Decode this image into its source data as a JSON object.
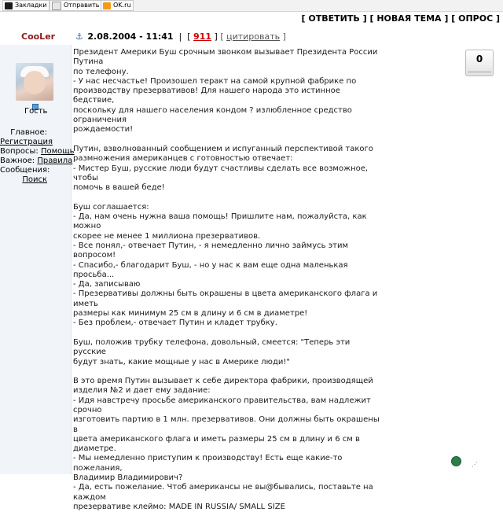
{
  "toolbar": {
    "bookmarks_label": "Закладки",
    "send_label": "Отправить",
    "ok_label": "OK.ru"
  },
  "actions": {
    "reply": "ОТВЕТИТЬ",
    "new_topic": "НОВАЯ ТЕМА",
    "poll": "ОПРОС"
  },
  "post_header": {
    "author": "CooLer",
    "date": "2.08.2004 - 11:41",
    "post_number": "911",
    "quote_label": "цитировать"
  },
  "user": {
    "status": "Гость"
  },
  "menu": {
    "main_label": "Главное:",
    "main_link": "Регистрация",
    "questions_label": "Вопросы:",
    "questions_link": "Помощь",
    "important_label": "Важное:",
    "important_link": "Правила",
    "messages_label": "Сообщения:",
    "messages_link": "Поиск"
  },
  "rating": {
    "value": "0"
  },
  "post": {
    "p1": "Президент Америки Буш срочным звонком вызывает Президента России Путина\nпо телефону.\n- У нас несчастье! Произошел теракт на самой крупной фабрике по\nпроизводству презервативов! Для нашего народа это истинное бедствие,\nпоскольку для нашего населения кондом ? излюбленное средство ограничения\nрождаемости!",
    "p2": "Путин, взволнованный сообщением и испуганный перспективой такого\nразмножения американцев с готовностью отвечает:\n- Мистер Буш, русские люди будут счастливы сделать все возможное, чтобы\nпомочь в вашей беде!",
    "p3": "Буш соглашается:\n- Да, нам очень нужна ваша помощь! Пришлите нам, пожалуйста, как можно\nскорее не менее 1 миллиона презервативов.\n- Все понял,- отвечает Путин, - я немедленно лично займусь этим\nвопросом!\n- Спасибо,- благодарит Буш, - но у нас к вам еще одна маленькая\nпросьба...\n- Да, записываю\n- Презервативы должны быть окрашены в цвета американского флага и иметь\nразмеры как минимум 25 см в длину и 6 см в диаметре!\n- Без проблем,- отвечает Путин и кладет трубку.",
    "p4": "Буш, положив трубку телефона, довольный, смеется: \"Теперь эти русские\nбудут знать, какие мощные у нас в Америке люди!\"",
    "p5": "В это время Путин вызывает к себе директора фабрики, производящей\nизделия №2 и дает ему задание:\n- Идя навстречу просьбе американского правительства, вам надлежит срочно\nизготовить партию в 1 млн. презервативов. Они должны быть окрашены в\nцвета американского флага и иметь размеры 25 см в длину и 6 см в диаметре.\n- Мы немедленно приступим к производству! Есть еще какие-то пожелания,\nВладимир Владимирович?\n- Да, есть пожелание. Чтоб американсы не вы@бывались, поставьте на каждом\nпрезервативе клеймо: MADE IN RUSSIA/ SMALL SIZE"
  }
}
